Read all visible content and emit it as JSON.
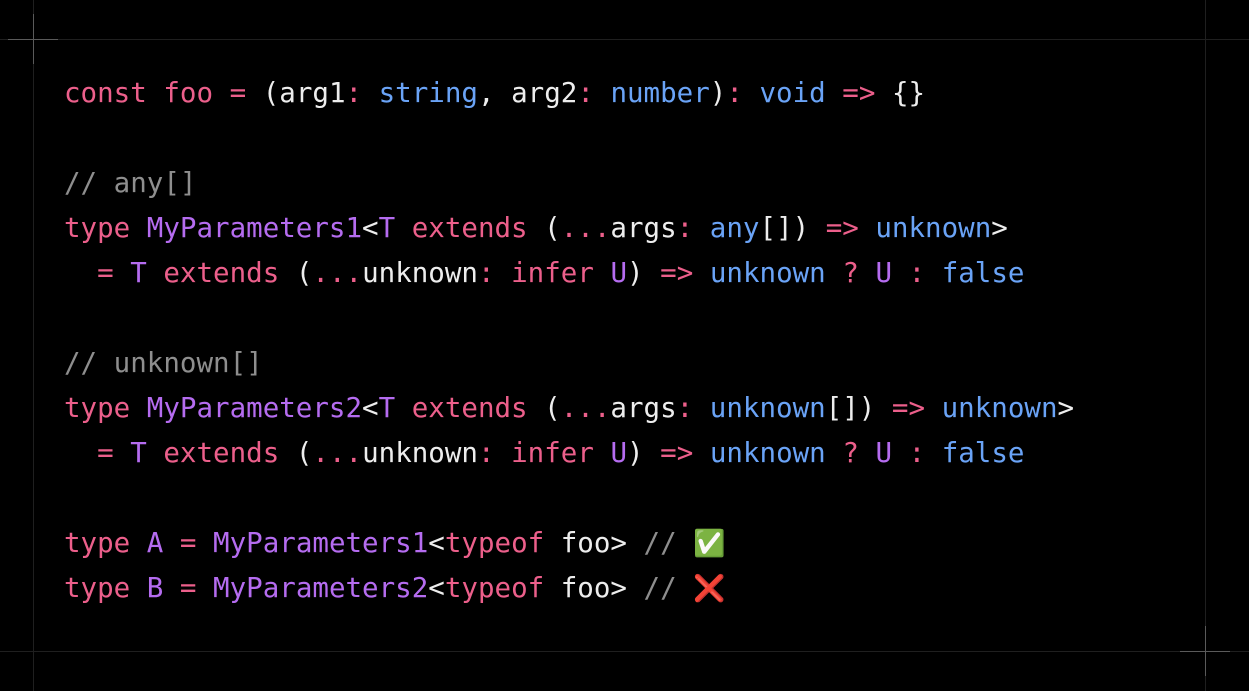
{
  "code": {
    "lines": [
      [
        {
          "text": "const",
          "role": "keyword"
        },
        {
          "text": " ",
          "role": "plain"
        },
        {
          "text": "foo",
          "role": "keyword"
        },
        {
          "text": " ",
          "role": "plain"
        },
        {
          "text": "=",
          "role": "keyword"
        },
        {
          "text": " (arg1",
          "role": "plain"
        },
        {
          "text": ":",
          "role": "keyword"
        },
        {
          "text": " ",
          "role": "plain"
        },
        {
          "text": "string",
          "role": "type"
        },
        {
          "text": ", arg2",
          "role": "plain"
        },
        {
          "text": ":",
          "role": "keyword"
        },
        {
          "text": " ",
          "role": "plain"
        },
        {
          "text": "number",
          "role": "type"
        },
        {
          "text": ")",
          "role": "plain"
        },
        {
          "text": ":",
          "role": "keyword"
        },
        {
          "text": " ",
          "role": "plain"
        },
        {
          "text": "void",
          "role": "type"
        },
        {
          "text": " ",
          "role": "plain"
        },
        {
          "text": "=>",
          "role": "keyword"
        },
        {
          "text": " {}",
          "role": "plain"
        }
      ],
      [],
      [
        {
          "text": "// any[]",
          "role": "comment"
        }
      ],
      [
        {
          "text": "type",
          "role": "keyword"
        },
        {
          "text": " ",
          "role": "plain"
        },
        {
          "text": "MyParameters1",
          "role": "name"
        },
        {
          "text": "<",
          "role": "plain"
        },
        {
          "text": "T",
          "role": "name"
        },
        {
          "text": " ",
          "role": "plain"
        },
        {
          "text": "extends",
          "role": "keyword"
        },
        {
          "text": " (",
          "role": "plain"
        },
        {
          "text": "...",
          "role": "keyword"
        },
        {
          "text": "args",
          "role": "plain"
        },
        {
          "text": ":",
          "role": "keyword"
        },
        {
          "text": " ",
          "role": "plain"
        },
        {
          "text": "any",
          "role": "type"
        },
        {
          "text": "[]) ",
          "role": "plain"
        },
        {
          "text": "=>",
          "role": "keyword"
        },
        {
          "text": " ",
          "role": "plain"
        },
        {
          "text": "unknown",
          "role": "type"
        },
        {
          "text": ">",
          "role": "plain"
        }
      ],
      [
        {
          "text": "  ",
          "role": "plain"
        },
        {
          "text": "=",
          "role": "keyword"
        },
        {
          "text": " ",
          "role": "plain"
        },
        {
          "text": "T",
          "role": "name"
        },
        {
          "text": " ",
          "role": "plain"
        },
        {
          "text": "extends",
          "role": "keyword"
        },
        {
          "text": " (",
          "role": "plain"
        },
        {
          "text": "...",
          "role": "keyword"
        },
        {
          "text": "unknown",
          "role": "plain"
        },
        {
          "text": ":",
          "role": "keyword"
        },
        {
          "text": " ",
          "role": "plain"
        },
        {
          "text": "infer",
          "role": "keyword"
        },
        {
          "text": " ",
          "role": "plain"
        },
        {
          "text": "U",
          "role": "name"
        },
        {
          "text": ") ",
          "role": "plain"
        },
        {
          "text": "=>",
          "role": "keyword"
        },
        {
          "text": " ",
          "role": "plain"
        },
        {
          "text": "unknown",
          "role": "type"
        },
        {
          "text": " ",
          "role": "plain"
        },
        {
          "text": "?",
          "role": "keyword"
        },
        {
          "text": " ",
          "role": "plain"
        },
        {
          "text": "U",
          "role": "name"
        },
        {
          "text": " ",
          "role": "plain"
        },
        {
          "text": ":",
          "role": "keyword"
        },
        {
          "text": " ",
          "role": "plain"
        },
        {
          "text": "false",
          "role": "type"
        }
      ],
      [],
      [
        {
          "text": "// unknown[]",
          "role": "comment"
        }
      ],
      [
        {
          "text": "type",
          "role": "keyword"
        },
        {
          "text": " ",
          "role": "plain"
        },
        {
          "text": "MyParameters2",
          "role": "name"
        },
        {
          "text": "<",
          "role": "plain"
        },
        {
          "text": "T",
          "role": "name"
        },
        {
          "text": " ",
          "role": "plain"
        },
        {
          "text": "extends",
          "role": "keyword"
        },
        {
          "text": " (",
          "role": "plain"
        },
        {
          "text": "...",
          "role": "keyword"
        },
        {
          "text": "args",
          "role": "plain"
        },
        {
          "text": ":",
          "role": "keyword"
        },
        {
          "text": " ",
          "role": "plain"
        },
        {
          "text": "unknown",
          "role": "type"
        },
        {
          "text": "[]) ",
          "role": "plain"
        },
        {
          "text": "=>",
          "role": "keyword"
        },
        {
          "text": " ",
          "role": "plain"
        },
        {
          "text": "unknown",
          "role": "type"
        },
        {
          "text": ">",
          "role": "plain"
        }
      ],
      [
        {
          "text": "  ",
          "role": "plain"
        },
        {
          "text": "=",
          "role": "keyword"
        },
        {
          "text": " ",
          "role": "plain"
        },
        {
          "text": "T",
          "role": "name"
        },
        {
          "text": " ",
          "role": "plain"
        },
        {
          "text": "extends",
          "role": "keyword"
        },
        {
          "text": " (",
          "role": "plain"
        },
        {
          "text": "...",
          "role": "keyword"
        },
        {
          "text": "unknown",
          "role": "plain"
        },
        {
          "text": ":",
          "role": "keyword"
        },
        {
          "text": " ",
          "role": "plain"
        },
        {
          "text": "infer",
          "role": "keyword"
        },
        {
          "text": " ",
          "role": "plain"
        },
        {
          "text": "U",
          "role": "name"
        },
        {
          "text": ") ",
          "role": "plain"
        },
        {
          "text": "=>",
          "role": "keyword"
        },
        {
          "text": " ",
          "role": "plain"
        },
        {
          "text": "unknown",
          "role": "type"
        },
        {
          "text": " ",
          "role": "plain"
        },
        {
          "text": "?",
          "role": "keyword"
        },
        {
          "text": " ",
          "role": "plain"
        },
        {
          "text": "U",
          "role": "name"
        },
        {
          "text": " ",
          "role": "plain"
        },
        {
          "text": ":",
          "role": "keyword"
        },
        {
          "text": " ",
          "role": "plain"
        },
        {
          "text": "false",
          "role": "type"
        }
      ],
      [],
      [
        {
          "text": "type",
          "role": "keyword"
        },
        {
          "text": " ",
          "role": "plain"
        },
        {
          "text": "A",
          "role": "name"
        },
        {
          "text": " ",
          "role": "plain"
        },
        {
          "text": "=",
          "role": "keyword"
        },
        {
          "text": " ",
          "role": "plain"
        },
        {
          "text": "MyParameters1",
          "role": "name"
        },
        {
          "text": "<",
          "role": "plain"
        },
        {
          "text": "typeof",
          "role": "keyword"
        },
        {
          "text": " foo> ",
          "role": "plain"
        },
        {
          "text": "// ",
          "role": "comment"
        },
        {
          "text": "✅",
          "role": "emoji-ok"
        }
      ],
      [
        {
          "text": "type",
          "role": "keyword"
        },
        {
          "text": " ",
          "role": "plain"
        },
        {
          "text": "B",
          "role": "name"
        },
        {
          "text": " ",
          "role": "plain"
        },
        {
          "text": "=",
          "role": "keyword"
        },
        {
          "text": " ",
          "role": "plain"
        },
        {
          "text": "MyParameters2",
          "role": "name"
        },
        {
          "text": "<",
          "role": "plain"
        },
        {
          "text": "typeof",
          "role": "keyword"
        },
        {
          "text": " foo> ",
          "role": "plain"
        },
        {
          "text": "// ",
          "role": "comment"
        },
        {
          "text": "❌",
          "role": "emoji-bad"
        }
      ]
    ]
  },
  "colors": {
    "background": "#000000",
    "keyword": "#ec5f8b",
    "type": "#6aa3f6",
    "name": "#b56cf0",
    "plain": "#ededed",
    "comment": "#8e8e8e",
    "guide": "#1f1f1f"
  },
  "icons": [
    "check-mark-icon",
    "cross-mark-icon",
    "corner-crosshair-icon"
  ]
}
